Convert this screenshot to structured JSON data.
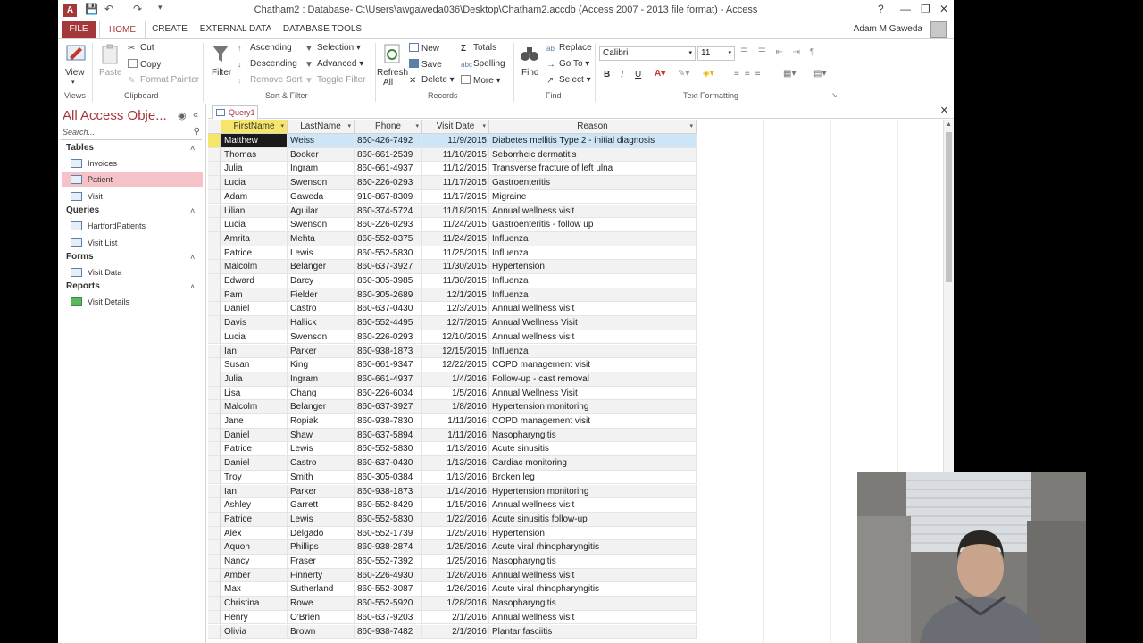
{
  "window": {
    "title": "Chatham2 : Database- C:\\Users\\awgaweda036\\Desktop\\Chatham2.accdb (Access 2007 - 2013 file format) - Access",
    "help": "?",
    "user_name": "Adam M Gaweda"
  },
  "tabs": [
    "FILE",
    "HOME",
    "CREATE",
    "EXTERNAL DATA",
    "DATABASE TOOLS"
  ],
  "ribbon": {
    "views": {
      "view": "View",
      "group": "Views"
    },
    "clipboard": {
      "paste": "Paste",
      "cut": "Cut",
      "copy": "Copy",
      "format_painter": "Format Painter",
      "group": "Clipboard"
    },
    "sort_filter": {
      "filter": "Filter",
      "ascending": "Ascending",
      "descending": "Descending",
      "remove_sort": "Remove Sort",
      "selection": "Selection",
      "advanced": "Advanced",
      "toggle_filter": "Toggle Filter",
      "group": "Sort & Filter"
    },
    "records": {
      "refresh": "Refresh",
      "refresh2": "All",
      "new": "New",
      "save": "Save",
      "delete": "Delete",
      "totals": "Totals",
      "spelling": "Spelling",
      "more": "More",
      "group": "Records"
    },
    "find": {
      "find": "Find",
      "replace": "Replace",
      "goto": "Go To",
      "select": "Select",
      "group": "Find"
    },
    "text_formatting": {
      "font": "Calibri",
      "size": "11",
      "bold": "B",
      "italic": "I",
      "underline": "U",
      "group": "Text Formatting"
    }
  },
  "nav": {
    "title": "All Access Obje...",
    "search_placeholder": "Search...",
    "sections": [
      {
        "name": "Tables",
        "items": [
          "Invoices",
          "Patient",
          "Visit"
        ]
      },
      {
        "name": "Queries",
        "items": [
          "HartfordPatients",
          "Visit List"
        ]
      },
      {
        "name": "Forms",
        "items": [
          "Visit Data"
        ]
      },
      {
        "name": "Reports",
        "items": [
          "Visit Details"
        ]
      }
    ]
  },
  "document": {
    "tab": "Query1"
  },
  "datasheet": {
    "columns": [
      "FirstName",
      "LastName",
      "Phone",
      "Visit Date",
      "Reason"
    ],
    "rows": [
      [
        "Matthew",
        "Weiss",
        "860-426-7492",
        "11/9/2015",
        "Diabetes mellitis Type 2 - initial diagnosis"
      ],
      [
        "Thomas",
        "Booker",
        "860-661-2539",
        "11/10/2015",
        "Seborrheic dermatitis"
      ],
      [
        "Julia",
        "Ingram",
        "860-661-4937",
        "11/12/2015",
        "Transverse fracture of left ulna"
      ],
      [
        "Lucia",
        "Swenson",
        "860-226-0293",
        "11/17/2015",
        "Gastroenteritis"
      ],
      [
        "Adam",
        "Gaweda",
        "910-867-8309",
        "11/17/2015",
        "Migraine"
      ],
      [
        "Lilian",
        "Aguilar",
        "860-374-5724",
        "11/18/2015",
        "Annual wellness visit"
      ],
      [
        "Lucia",
        "Swenson",
        "860-226-0293",
        "11/24/2015",
        "Gastroenteritis - follow up"
      ],
      [
        "Amrita",
        "Mehta",
        "860-552-0375",
        "11/24/2015",
        "Influenza"
      ],
      [
        "Patrice",
        "Lewis",
        "860-552-5830",
        "11/25/2015",
        "Influenza"
      ],
      [
        "Malcolm",
        "Belanger",
        "860-637-3927",
        "11/30/2015",
        "Hypertension"
      ],
      [
        "Edward",
        "Darcy",
        "860-305-3985",
        "11/30/2015",
        "Influenza"
      ],
      [
        "Pam",
        "Fielder",
        "860-305-2689",
        "12/1/2015",
        "Influenza"
      ],
      [
        "Daniel",
        "Castro",
        "860-637-0430",
        "12/3/2015",
        "Annual wellness visit"
      ],
      [
        "Davis",
        "Hallick",
        "860-552-4495",
        "12/7/2015",
        "Annual Wellness Visit"
      ],
      [
        "Lucia",
        "Swenson",
        "860-226-0293",
        "12/10/2015",
        "Annual wellness visit"
      ],
      [
        "Ian",
        "Parker",
        "860-938-1873",
        "12/15/2015",
        "Influenza"
      ],
      [
        "Susan",
        "King",
        "860-661-9347",
        "12/22/2015",
        "COPD management visit"
      ],
      [
        "Julia",
        "Ingram",
        "860-661-4937",
        "1/4/2016",
        "Follow-up - cast removal"
      ],
      [
        "Lisa",
        "Chang",
        "860-226-6034",
        "1/5/2016",
        "Annual Wellness Visit"
      ],
      [
        "Malcolm",
        "Belanger",
        "860-637-3927",
        "1/8/2016",
        "Hypertension monitoring"
      ],
      [
        "Jane",
        "Ropiak",
        "860-938-7830",
        "1/11/2016",
        "COPD management visit"
      ],
      [
        "Daniel",
        "Shaw",
        "860-637-5894",
        "1/11/2016",
        "Nasopharyngitis"
      ],
      [
        "Patrice",
        "Lewis",
        "860-552-5830",
        "1/13/2016",
        "Acute sinusitis"
      ],
      [
        "Daniel",
        "Castro",
        "860-637-0430",
        "1/13/2016",
        "Cardiac monitoring"
      ],
      [
        "Troy",
        "Smith",
        "860-305-0384",
        "1/13/2016",
        "Broken leg"
      ],
      [
        "Ian",
        "Parker",
        "860-938-1873",
        "1/14/2016",
        "Hypertension monitoring"
      ],
      [
        "Ashley",
        "Garrett",
        "860-552-8429",
        "1/15/2016",
        "Annual wellness visit"
      ],
      [
        "Patrice",
        "Lewis",
        "860-552-5830",
        "1/22/2016",
        "Acute sinusitis follow-up"
      ],
      [
        "Alex",
        "Delgado",
        "860-552-1739",
        "1/25/2016",
        "Hypertension"
      ],
      [
        "Aquon",
        "Phillips",
        "860-938-2874",
        "1/25/2016",
        "Acute viral rhinopharyngitis"
      ],
      [
        "Nancy",
        "Fraser",
        "860-552-7392",
        "1/25/2016",
        "Nasopharyngitis"
      ],
      [
        "Amber",
        "Finnerty",
        "860-226-4930",
        "1/26/2016",
        "Annual wellness visit"
      ],
      [
        "Max",
        "Sutherland",
        "860-552-3087",
        "1/26/2016",
        "Acute viral rhinopharyngitis"
      ],
      [
        "Christina",
        "Rowe",
        "860-552-5920",
        "1/28/2016",
        "Nasopharyngitis"
      ],
      [
        "Henry",
        "O'Brien",
        "860-637-9203",
        "2/1/2016",
        "Annual wellness visit"
      ],
      [
        "Olivia",
        "Brown",
        "860-938-7482",
        "2/1/2016",
        "Plantar fasciitis"
      ]
    ]
  },
  "colors": {
    "accent": "#a4373a",
    "sort_header": "#f5e66a",
    "selected_row": "#cde6f7"
  }
}
